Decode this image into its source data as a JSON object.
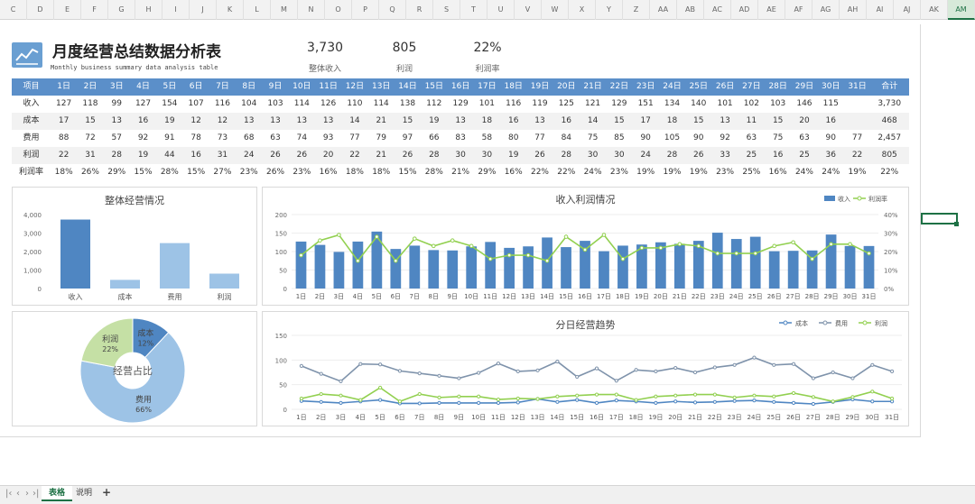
{
  "columns": [
    "C",
    "D",
    "E",
    "F",
    "G",
    "H",
    "I",
    "J",
    "K",
    "L",
    "M",
    "N",
    "O",
    "P",
    "Q",
    "R",
    "S",
    "T",
    "U",
    "V",
    "W",
    "X",
    "Y",
    "Z",
    "AA",
    "AB",
    "AC",
    "AD",
    "AE",
    "AF",
    "AG",
    "AH",
    "AI",
    "AJ",
    "AK",
    "AM"
  ],
  "header": {
    "title": "月度经营总结数据分析表",
    "subtitle": "Monthly business summary data analysis table",
    "kpis": [
      {
        "value": "3,730",
        "label": "整体收入"
      },
      {
        "value": "805",
        "label": "利润"
      },
      {
        "value": "22%",
        "label": "利润率"
      }
    ]
  },
  "table": {
    "header_label": "项目",
    "days": [
      "1日",
      "2日",
      "3日",
      "4日",
      "5日",
      "6日",
      "7日",
      "8日",
      "9日",
      "10日",
      "11日",
      "12日",
      "13日",
      "14日",
      "15日",
      "16日",
      "17日",
      "18日",
      "19日",
      "20日",
      "21日",
      "22日",
      "23日",
      "24日",
      "25日",
      "26日",
      "27日",
      "28日",
      "29日",
      "30日",
      "31日"
    ],
    "total_label": "合计",
    "rows": [
      {
        "label": "收入",
        "values": [
          "127",
          "118",
          "99",
          "127",
          "154",
          "107",
          "116",
          "104",
          "103",
          "114",
          "126",
          "110",
          "114",
          "138",
          "112",
          "129",
          "101",
          "116",
          "119",
          "125",
          "121",
          "129",
          "151",
          "134",
          "140",
          "101",
          "102",
          "103",
          "146",
          "115"
        ],
        "extra": "3,730"
      },
      {
        "label": "成本",
        "values": [
          "17",
          "15",
          "13",
          "16",
          "19",
          "12",
          "12",
          "13",
          "13",
          "13",
          "13",
          "14",
          "21",
          "15",
          "19",
          "13",
          "18",
          "16",
          "13",
          "16",
          "14",
          "15",
          "17",
          "18",
          "15",
          "13",
          "11",
          "15",
          "20",
          "16"
        ],
        "extra": "468"
      },
      {
        "label": "费用",
        "values": [
          "88",
          "72",
          "57",
          "92",
          "91",
          "78",
          "73",
          "68",
          "63",
          "74",
          "93",
          "77",
          "79",
          "97",
          "66",
          "83",
          "58",
          "80",
          "77",
          "84",
          "75",
          "85",
          "90",
          "105",
          "90",
          "92",
          "63",
          "75",
          "63",
          "90",
          "77"
        ],
        "total": "2,457"
      },
      {
        "label": "利润",
        "values": [
          "22",
          "31",
          "28",
          "19",
          "44",
          "16",
          "31",
          "24",
          "26",
          "26",
          "20",
          "22",
          "21",
          "26",
          "28",
          "30",
          "30",
          "19",
          "26",
          "28",
          "30",
          "30",
          "24",
          "28",
          "26",
          "33",
          "25",
          "16",
          "25",
          "36",
          "22"
        ],
        "total": "805"
      },
      {
        "label": "利润率",
        "values": [
          "18%",
          "26%",
          "29%",
          "15%",
          "28%",
          "15%",
          "27%",
          "23%",
          "26%",
          "23%",
          "16%",
          "18%",
          "18%",
          "15%",
          "28%",
          "21%",
          "29%",
          "16%",
          "22%",
          "22%",
          "24%",
          "23%",
          "19%",
          "19%",
          "19%",
          "23%",
          "25%",
          "16%",
          "24%",
          "24%",
          "19%"
        ],
        "total": "22%"
      }
    ]
  },
  "chart_data": [
    {
      "type": "bar",
      "title": "整体经营情况",
      "categories": [
        "收入",
        "成本",
        "费用",
        "利润"
      ],
      "values": [
        3730,
        468,
        2457,
        805
      ],
      "ylim": [
        0,
        4000
      ],
      "yticks": [
        "0",
        "1,000",
        "2,000",
        "3,000",
        "4,000"
      ],
      "colors": [
        "#4f86c2",
        "#9dc3e6",
        "#9dc3e6",
        "#9dc3e6"
      ]
    },
    {
      "type": "bar",
      "title": "收入利润情况",
      "categories": [
        "1日",
        "2日",
        "3日",
        "4日",
        "5日",
        "6日",
        "7日",
        "8日",
        "9日",
        "10日",
        "11日",
        "12日",
        "13日",
        "14日",
        "15日",
        "16日",
        "17日",
        "18日",
        "19日",
        "20日",
        "21日",
        "22日",
        "23日",
        "24日",
        "25日",
        "26日",
        "27日",
        "28日",
        "29日",
        "30日",
        "31日"
      ],
      "series": [
        {
          "name": "收入",
          "type": "bar",
          "color": "#4f86c2",
          "values": [
            127,
            118,
            99,
            127,
            154,
            107,
            116,
            104,
            103,
            114,
            126,
            110,
            114,
            138,
            112,
            129,
            101,
            116,
            119,
            125,
            121,
            129,
            151,
            134,
            140,
            101,
            102,
            103,
            146,
            115,
            115
          ]
        },
        {
          "name": "利润率",
          "type": "line",
          "color": "#92d050",
          "values": [
            0.18,
            0.26,
            0.29,
            0.15,
            0.28,
            0.15,
            0.27,
            0.23,
            0.26,
            0.23,
            0.16,
            0.18,
            0.18,
            0.15,
            0.28,
            0.21,
            0.29,
            0.16,
            0.22,
            0.22,
            0.24,
            0.23,
            0.19,
            0.19,
            0.19,
            0.23,
            0.25,
            0.16,
            0.24,
            0.24,
            0.19
          ]
        }
      ],
      "ylim": [
        0,
        200
      ],
      "yticks": [
        "0",
        "50",
        "100",
        "150",
        "200"
      ],
      "y2lim": [
        0,
        0.4
      ],
      "y2ticks": [
        "0%",
        "10%",
        "20%",
        "30%",
        "40%"
      ],
      "legend_position": "top-right"
    },
    {
      "type": "pie",
      "center_label": "经营占比",
      "slices": [
        {
          "name": "成本",
          "pct_label": "12%",
          "value": 12,
          "color": "#4f86c2"
        },
        {
          "name": "费用",
          "pct_label": "66%",
          "value": 66,
          "color": "#9dc3e6"
        },
        {
          "name": "利润",
          "pct_label": "22%",
          "value": 22,
          "color": "#c5e0a5"
        }
      ]
    },
    {
      "type": "line",
      "title": "分日经营趋势",
      "categories": [
        "1日",
        "2日",
        "3日",
        "4日",
        "5日",
        "6日",
        "7日",
        "8日",
        "9日",
        "10日",
        "11日",
        "12日",
        "13日",
        "14日",
        "15日",
        "16日",
        "17日",
        "18日",
        "19日",
        "20日",
        "21日",
        "22日",
        "23日",
        "24日",
        "25日",
        "26日",
        "27日",
        "28日",
        "29日",
        "30日",
        "31日"
      ],
      "series": [
        {
          "name": "成本",
          "color": "#4f86c2",
          "values": [
            17,
            15,
            13,
            16,
            19,
            12,
            12,
            13,
            13,
            13,
            13,
            14,
            21,
            15,
            19,
            13,
            18,
            16,
            13,
            16,
            14,
            15,
            17,
            18,
            15,
            13,
            11,
            15,
            20,
            16,
            16
          ]
        },
        {
          "name": "费用",
          "color": "#7f93ab",
          "values": [
            88,
            72,
            57,
            92,
            91,
            78,
            73,
            68,
            63,
            74,
            93,
            77,
            79,
            97,
            66,
            83,
            58,
            80,
            77,
            84,
            75,
            85,
            90,
            105,
            90,
            92,
            63,
            75,
            63,
            90,
            77
          ]
        },
        {
          "name": "利润",
          "color": "#92d050",
          "values": [
            22,
            31,
            28,
            19,
            44,
            16,
            31,
            24,
            26,
            26,
            20,
            22,
            21,
            26,
            28,
            30,
            30,
            19,
            26,
            28,
            30,
            30,
            24,
            28,
            26,
            33,
            25,
            16,
            25,
            36,
            22
          ]
        }
      ],
      "ylim": [
        0,
        150
      ],
      "yticks": [
        "0",
        "50",
        "100",
        "150"
      ],
      "legend_position": "top-right"
    }
  ],
  "sheet_tabs": {
    "tabs": [
      "表格",
      "说明"
    ],
    "active": "表格",
    "add_label": "+"
  }
}
